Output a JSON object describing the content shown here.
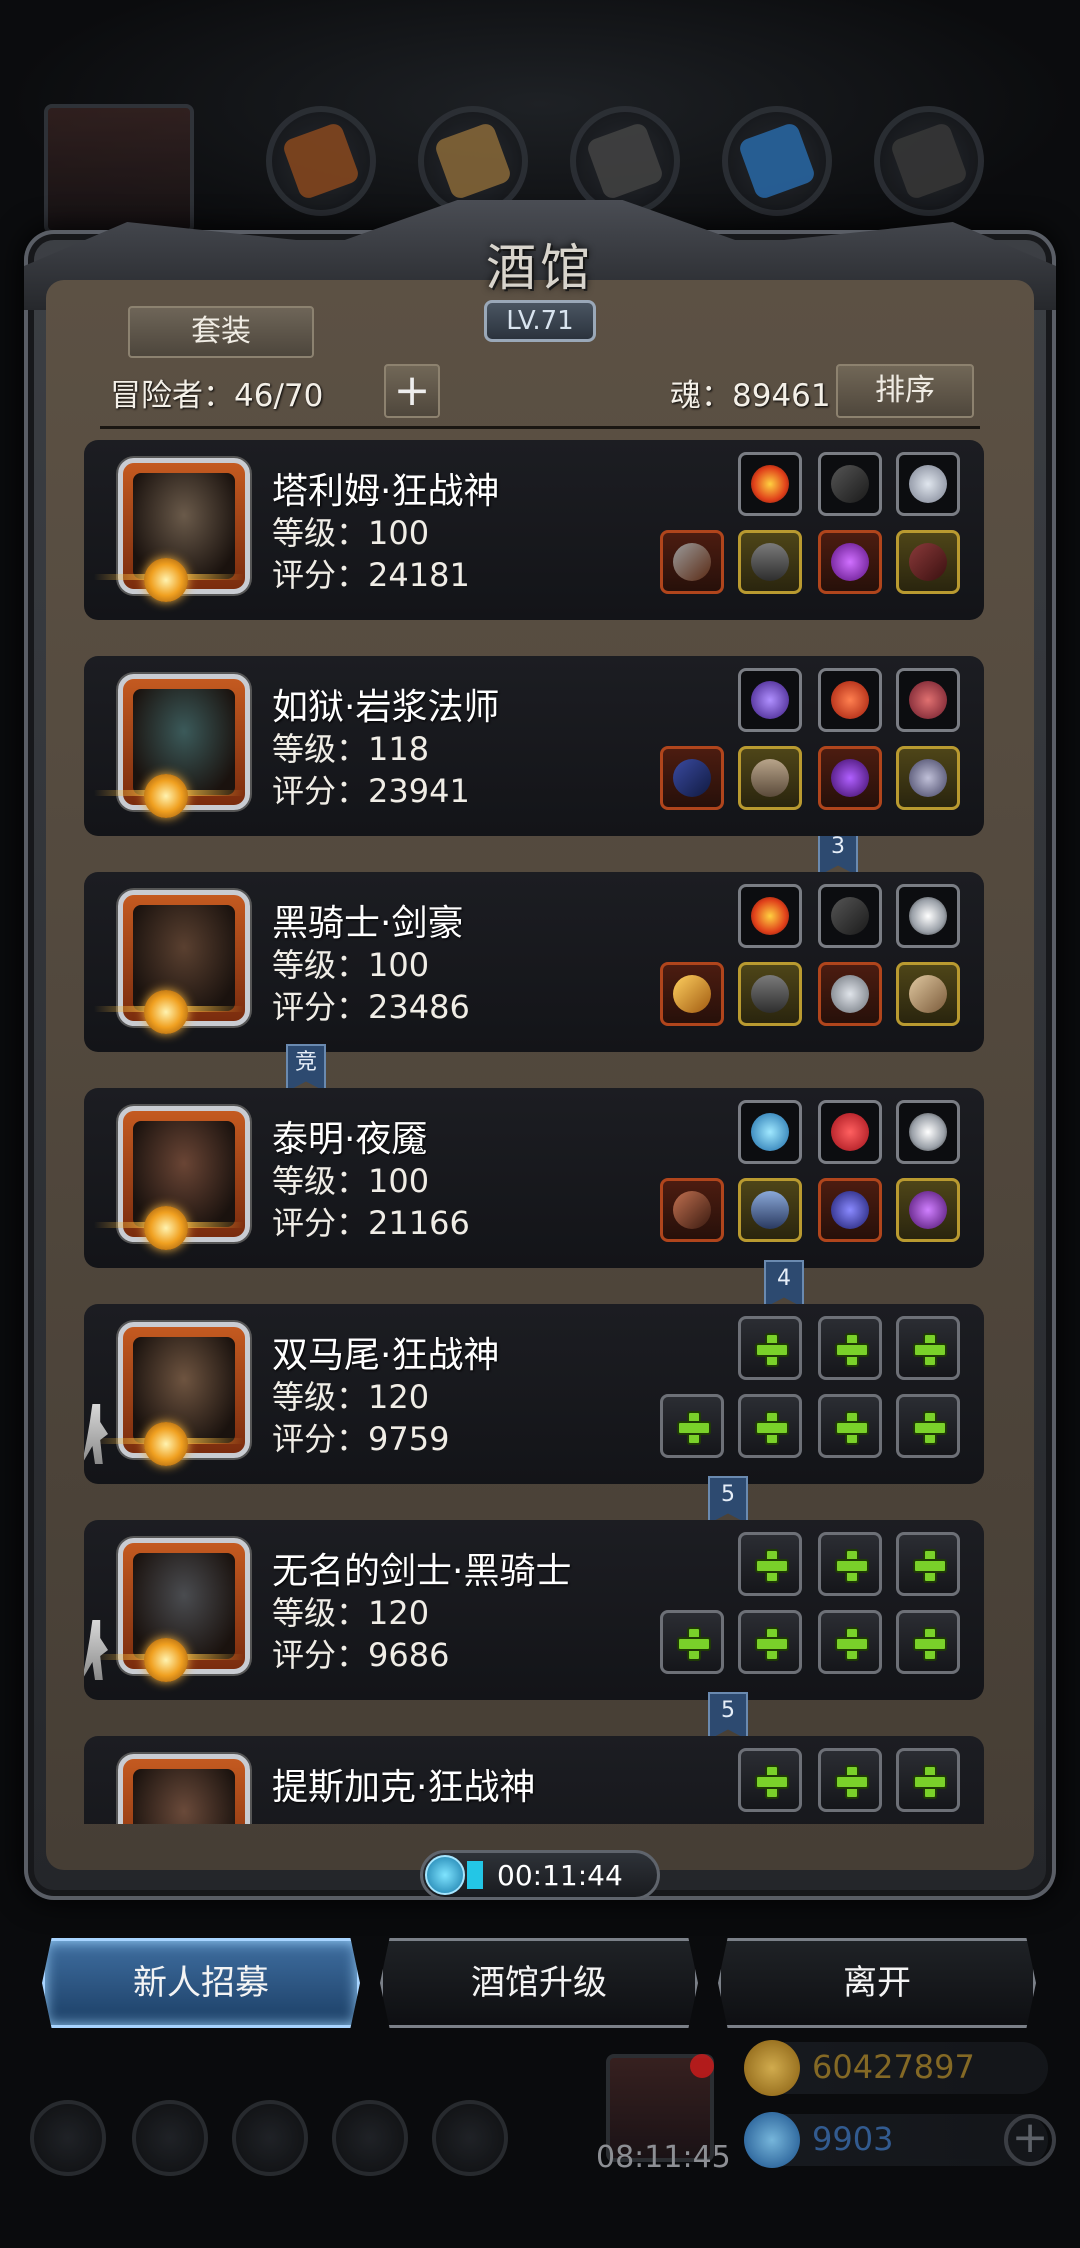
{
  "header": {
    "title": "酒馆",
    "level": "LV.71"
  },
  "toolbar": {
    "suit_label": "套装",
    "adventurer_count": "冒险者：46/70",
    "plus_label": "+",
    "soul": "魂：89461",
    "sort_label": "排序"
  },
  "heroes": [
    {
      "name": "塔利姆·狂战神",
      "level": "等级：100",
      "score": "评分：24181",
      "portrait_color": "#6a5a4a",
      "top_slots": [
        "fire-gem",
        "dark-feather",
        "silver-emblem"
      ],
      "bottom_slots": [
        "axe",
        "armor",
        "purple-helmet",
        "boots"
      ],
      "ribbon": "3"
    },
    {
      "name": "如狱·岩浆法师",
      "level": "等级：118",
      "score": "评分：23941",
      "portrait_color": "#3b5a5a",
      "top_slots": [
        "purple-orb",
        "red-gem",
        "chain-necklace"
      ],
      "bottom_slots": [
        "staff",
        "robe",
        "amulet",
        "pentagram"
      ],
      "ribbon": ""
    },
    {
      "name": "黑骑士·剑豪",
      "level": "等级：100",
      "score": "评分：23486",
      "portrait_color": "#5a4030",
      "top_slots": [
        "fire-gem",
        "dark-feather",
        "silver-crescent"
      ],
      "bottom_slots": [
        "golden-blade",
        "armor",
        "silver-helmet",
        "gauntlet"
      ],
      "ribbon": "竞"
    },
    {
      "name": "泰明·夜魇",
      "level": "等级：100",
      "score": "评分：21166",
      "portrait_color": "#6a4535",
      "top_slots": [
        "blue-orb",
        "ruby",
        "silver-crescent"
      ],
      "bottom_slots": [
        "spear",
        "blue-armor",
        "blue-mask",
        "purple-amulet"
      ],
      "ribbon": "4"
    },
    {
      "name": "双马尾·狂战神",
      "level": "等级：120",
      "score": "评分：9759",
      "portrait_color": "#6e5440",
      "top_slots": [
        "add",
        "add",
        "add"
      ],
      "bottom_slots": [
        "add",
        "add",
        "add",
        "add"
      ],
      "ribbon": "5"
    },
    {
      "name": "无名的剑士·黑骑士",
      "level": "等级：120",
      "score": "评分：9686",
      "portrait_color": "#4a4c50",
      "top_slots": [
        "add",
        "add",
        "add"
      ],
      "bottom_slots": [
        "add",
        "add",
        "add",
        "add"
      ],
      "ribbon": "5"
    },
    {
      "name": "提斯加克·狂战神",
      "level": "",
      "score": "",
      "portrait_color": "#6a4a3a",
      "top_slots": [
        "add",
        "add",
        "add"
      ],
      "bottom_slots": [],
      "ribbon": ""
    }
  ],
  "timer": "00:11:44",
  "actions": {
    "recruit": "新人招募",
    "upgrade": "酒馆升级",
    "leave": "离开"
  },
  "background_hud": {
    "gold": "60427897",
    "gems": "9903",
    "gift_timer": "08:11:45"
  },
  "colors": {
    "accent_blue": "#3f6ea0",
    "plus_green": "#7ad12a",
    "panel_brown": "#5c5144",
    "card_dark": "#16171b"
  }
}
